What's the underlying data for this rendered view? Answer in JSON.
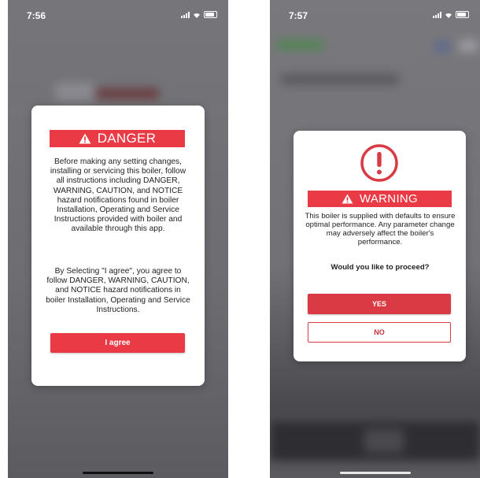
{
  "left_screen": {
    "time": "7:56",
    "modal": {
      "banner_label": "DANGER",
      "paragraph1": "Before making any setting changes, installing or servicing this boiler, follow all instructions including DANGER, WARNING, CAUTION, and NOTICE hazard notifications found in boiler Installation, Operating and Service Instructions provided with boiler and available through this app.",
      "paragraph2": "By Selecting \"I agree\", you agree to follow DANGER, WARNING, CAUTION, and NOTICE hazard notifications in boiler Installation, Operating and Service Instructions.",
      "agree_label": "I agree"
    }
  },
  "right_screen": {
    "time": "7:57",
    "modal": {
      "banner_label": "WARNING",
      "paragraph": "This boiler is supplied with defaults to ensure optimal performance. Any parameter change may adversely affect the boiler's performance.",
      "question": "Would you like to proceed?",
      "yes_label": "YES",
      "no_label": "NO"
    }
  },
  "colors": {
    "accent_red": "#ea3a45",
    "overlay_gray": "#727276"
  },
  "icons": [
    "warning-triangle-icon",
    "alert-circle-icon",
    "signal-icon",
    "wifi-icon",
    "battery-icon"
  ]
}
